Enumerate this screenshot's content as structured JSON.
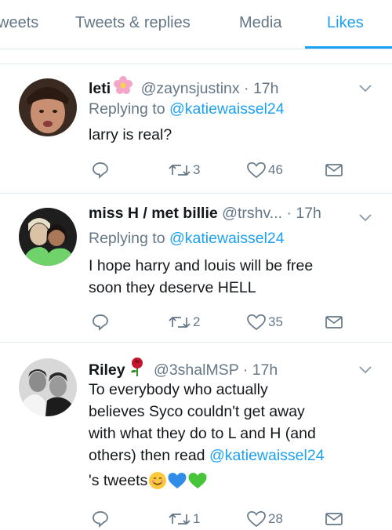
{
  "tabs": [
    {
      "label": "weets"
    },
    {
      "label": "Tweets & replies"
    },
    {
      "label": "Media"
    },
    {
      "label": "Likes"
    }
  ],
  "colors": {
    "accent": "#1da1f2",
    "secondary_text": "#657786",
    "divider": "#e1e8ed"
  },
  "tweets": [
    {
      "name": "leti",
      "emoji": "cherry-blossom-icon",
      "handle": "@zaynsjustinx",
      "time": "· 17h",
      "replying_prefix": "Replying to",
      "replying_handle": "@katiewaissel24",
      "text": "larry is real?",
      "retweets": "3",
      "likes": "46"
    },
    {
      "name": "miss H / met billie",
      "handle": "@trshv...",
      "time": "· 17h",
      "replying_prefix": "Replying to",
      "replying_handle": "@katiewaissel24",
      "text_line1": "I hope harry and louis will be free",
      "text_line2": "soon they deserve HELL",
      "retweets": "2",
      "likes": "35"
    },
    {
      "name": "Riley",
      "emoji": "rose-icon",
      "handle": "@3shalMSP",
      "time": "· 17h",
      "text_line1": "To everybody who actually",
      "text_line2": "believes Syco couldn't get away",
      "text_line3": "with what they do to L and H (and",
      "text_line4_prefix": "others) then read",
      "text_line4_link": "@katiewaissel24",
      "text_line5": "'s tweets",
      "text_emojis": [
        "smiling-face-icon",
        "blue-heart-icon",
        "green-heart-icon"
      ],
      "retweets": "1",
      "likes": "28"
    }
  ]
}
